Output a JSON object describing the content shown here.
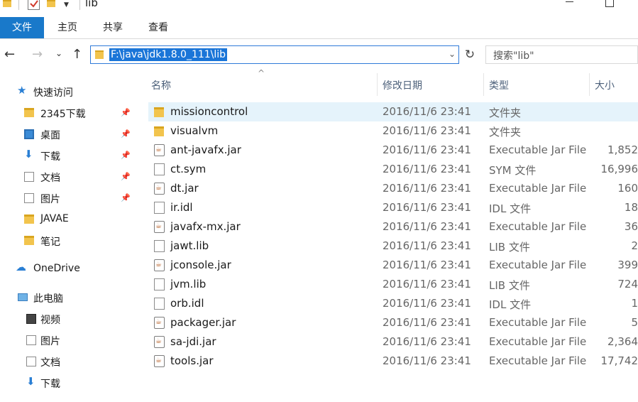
{
  "window": {
    "title": "lib"
  },
  "ribbon": {
    "tabs": [
      "文件",
      "主页",
      "共享",
      "查看"
    ]
  },
  "address": {
    "path": "F:\\java\\jdk1.8.0_111\\lib"
  },
  "search": {
    "placeholder": "搜索\"lib\""
  },
  "nav": {
    "quick_access": "快速访问",
    "quick_items": [
      "2345下载",
      "桌面",
      "下载",
      "文档",
      "图片",
      "JAVAE",
      "笔记"
    ],
    "onedrive": "OneDrive",
    "this_pc": "此电脑",
    "pc_items": [
      "视频",
      "图片",
      "文档",
      "下载"
    ]
  },
  "columns": {
    "name": "名称",
    "date": "修改日期",
    "type": "类型",
    "size": "大小"
  },
  "files": [
    {
      "name": "missioncontrol",
      "date": "2016/11/6 23:41",
      "type": "文件夹",
      "size": "",
      "icon": "folder-icon"
    },
    {
      "name": "visualvm",
      "date": "2016/11/6 23:41",
      "type": "文件夹",
      "size": "",
      "icon": "folder-icon"
    },
    {
      "name": "ant-javafx.jar",
      "date": "2016/11/6 23:41",
      "type": "Executable Jar File",
      "size": "1,852",
      "icon": "jar-icon"
    },
    {
      "name": "ct.sym",
      "date": "2016/11/6 23:41",
      "type": "SYM 文件",
      "size": "16,996",
      "icon": "file-icon"
    },
    {
      "name": "dt.jar",
      "date": "2016/11/6 23:41",
      "type": "Executable Jar File",
      "size": "160",
      "icon": "jar-icon"
    },
    {
      "name": "ir.idl",
      "date": "2016/11/6 23:41",
      "type": "IDL 文件",
      "size": "18",
      "icon": "file-icon"
    },
    {
      "name": "javafx-mx.jar",
      "date": "2016/11/6 23:41",
      "type": "Executable Jar File",
      "size": "36",
      "icon": "jar-icon"
    },
    {
      "name": "jawt.lib",
      "date": "2016/11/6 23:41",
      "type": "LIB 文件",
      "size": "2",
      "icon": "file-icon"
    },
    {
      "name": "jconsole.jar",
      "date": "2016/11/6 23:41",
      "type": "Executable Jar File",
      "size": "399",
      "icon": "jar-icon"
    },
    {
      "name": "jvm.lib",
      "date": "2016/11/6 23:41",
      "type": "LIB 文件",
      "size": "724",
      "icon": "file-icon"
    },
    {
      "name": "orb.idl",
      "date": "2016/11/6 23:41",
      "type": "IDL 文件",
      "size": "1",
      "icon": "file-icon"
    },
    {
      "name": "packager.jar",
      "date": "2016/11/6 23:41",
      "type": "Executable Jar File",
      "size": "5",
      "icon": "jar-icon"
    },
    {
      "name": "sa-jdi.jar",
      "date": "2016/11/6 23:41",
      "type": "Executable Jar File",
      "size": "2,364",
      "icon": "jar-icon"
    },
    {
      "name": "tools.jar",
      "date": "2016/11/6 23:41",
      "type": "Executable Jar File",
      "size": "17,742",
      "icon": "jar-icon"
    }
  ],
  "colors": {
    "accent": "#1979ca",
    "selection": "#e5f3fb",
    "address_highlight": "#1a75d8"
  }
}
